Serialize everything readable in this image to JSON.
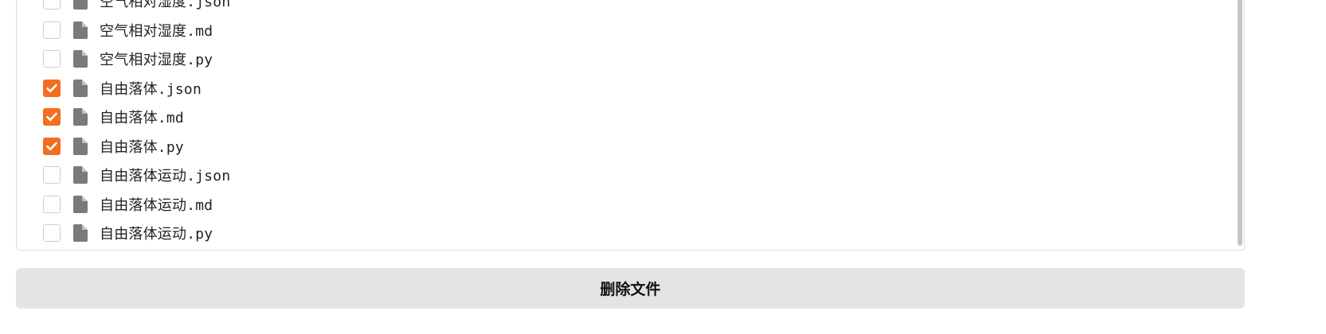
{
  "files": [
    {
      "name": "空气相对湿度.json",
      "checked": false
    },
    {
      "name": "空气相对湿度.md",
      "checked": false
    },
    {
      "name": "空气相对湿度.py",
      "checked": false
    },
    {
      "name": "自由落体.json",
      "checked": true
    },
    {
      "name": "自由落体.md",
      "checked": true
    },
    {
      "name": "自由落体.py",
      "checked": true
    },
    {
      "name": "自由落体运动.json",
      "checked": false
    },
    {
      "name": "自由落体运动.md",
      "checked": false
    },
    {
      "name": "自由落体运动.py",
      "checked": false
    }
  ],
  "icons": {
    "file": "file-icon",
    "check": "checkmark-icon"
  },
  "colors": {
    "accent": "#f26f1d",
    "file_icon": "#7a7a7a",
    "button_bg": "#e4e4e6"
  },
  "actions": {
    "delete_label": "删除文件"
  }
}
